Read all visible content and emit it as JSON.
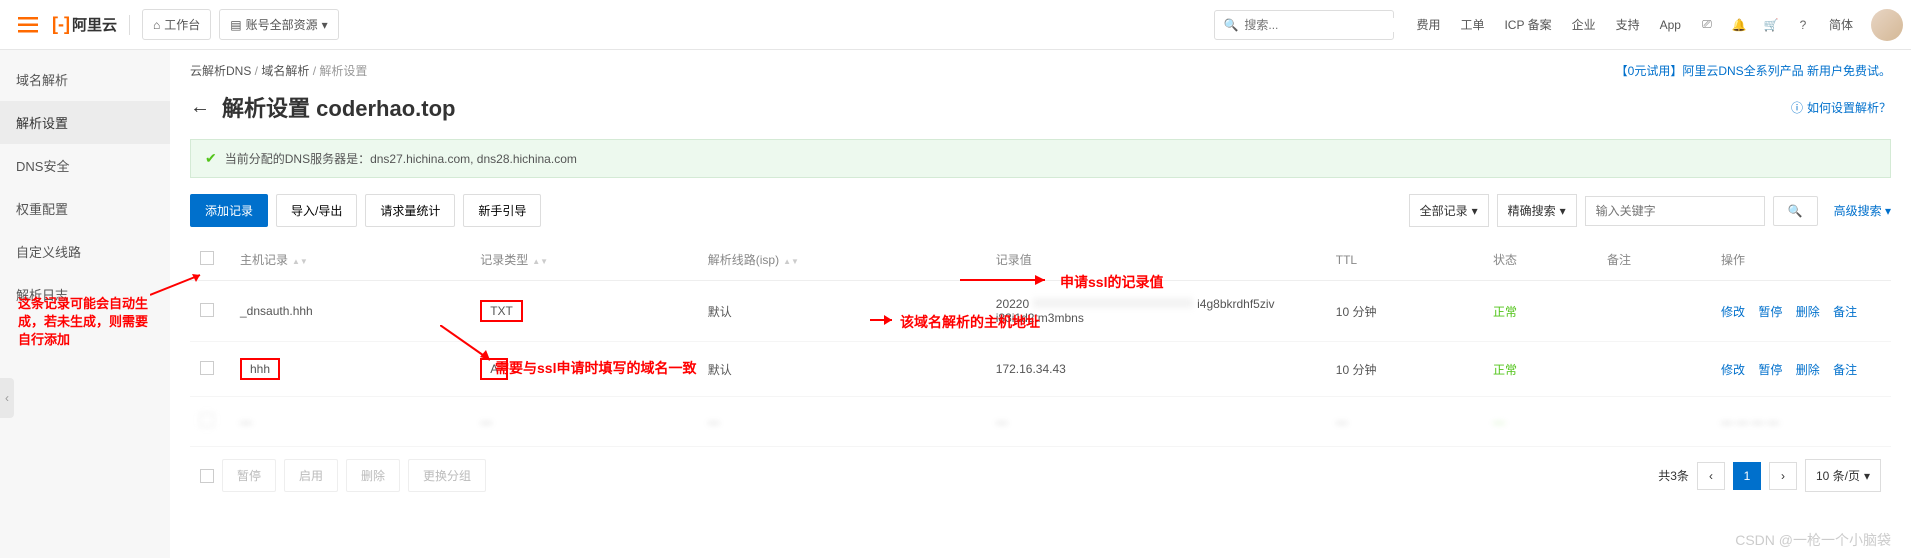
{
  "topbar": {
    "logo_text": "阿里云",
    "workspace_btn": "工作台",
    "resources_btn": "账号全部资源",
    "search_placeholder": "搜索...",
    "links": [
      "费用",
      "工单",
      "ICP 备案",
      "企业",
      "支持",
      "App"
    ],
    "lang": "简体"
  },
  "sidebar": {
    "items": [
      "域名解析",
      "解析设置",
      "DNS安全",
      "权重配置",
      "自定义线路",
      "解析日志"
    ],
    "active_index": 1
  },
  "breadcrumb": {
    "items": [
      "云解析DNS",
      "域名解析",
      "解析设置"
    ],
    "promo": "【0元试用】阿里云DNS全系列产品 新用户免费试。"
  },
  "page": {
    "title_prefix": "解析设置",
    "domain": "coderhao.top",
    "help_link": "如何设置解析？"
  },
  "alert": {
    "text": "当前分配的DNS服务器是：dns27.hichina.com, dns28.hichina.com"
  },
  "toolbar": {
    "add": "添加记录",
    "import": "导入/导出",
    "stats": "请求量统计",
    "guide": "新手引导",
    "filter_all": "全部记录",
    "search_mode": "精确搜索",
    "keyword_placeholder": "输入关键字",
    "adv": "高级搜索"
  },
  "table": {
    "headers": {
      "host": "主机记录",
      "type": "记录类型",
      "line": "解析线路(isp)",
      "value": "记录值",
      "ttl": "TTL",
      "status": "状态",
      "remark": "备注",
      "action": "操作"
    },
    "rows": [
      {
        "host": "_dnsauth.hhh",
        "type": "TXT",
        "line": "默认",
        "value_line1": "20220",
        "value_line2": "i83i1d2tm3mbns",
        "value_suffix": "i4g8bkrdhf5ziv",
        "ttl": "10 分钟",
        "status": "正常"
      },
      {
        "host": "hhh",
        "type": "A",
        "line": "默认",
        "value_line1": "172.16.34.43",
        "ttl": "10 分钟",
        "status": "正常"
      }
    ],
    "actions": {
      "edit": "修改",
      "pause": "暂停",
      "delete": "删除",
      "remark": "备注"
    }
  },
  "footer": {
    "batch": [
      "暂停",
      "启用",
      "删除",
      "更换分组"
    ],
    "total": "共3条",
    "per_page": "10 条/页"
  },
  "annotations": {
    "left_note": "这条记录可能会自动生成，若未生成，则需要自行添加",
    "ssl_value": "申请ssl的记录值",
    "host_addr": "该域名解析的主机地址",
    "domain_match": "需要与ssl申请时填写的域名一致"
  },
  "watermark": "CSDN @一枪一个小脑袋"
}
